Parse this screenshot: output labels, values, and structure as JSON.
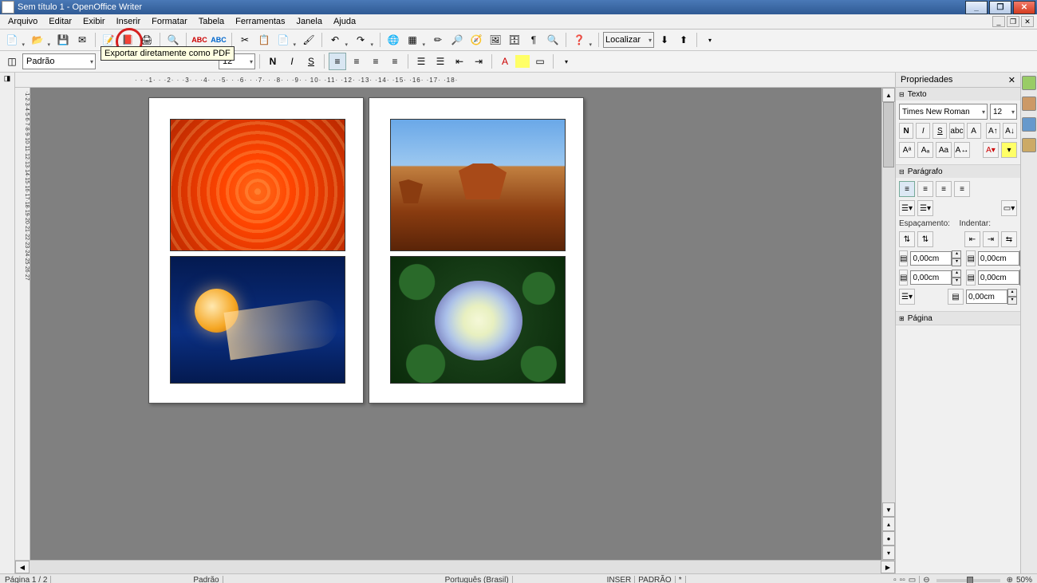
{
  "title": "Sem título 1 - OpenOffice Writer",
  "menu": [
    "Arquivo",
    "Editar",
    "Exibir",
    "Inserir",
    "Formatar",
    "Tabela",
    "Ferramentas",
    "Janela",
    "Ajuda"
  ],
  "tooltip": "Exportar diretamente como PDF",
  "find_placeholder": "Localizar",
  "style_combo": "Padrão",
  "font_combo": "Times New Roman",
  "size_combo": "12",
  "hruler": "· · ·1· · ·2· · ·3· · ·4· · ·5· · ·6· · ·7· · ·8· · ·9· · 10· ·11· ·12· ·13· ·14· ·15· ·16· ·17· ·18·",
  "vruler": "·1·2·3·4·5·6·7·8·9·10·11·12·13·14·15·16·17·18·19·20·21·22·23·24·25·26·27",
  "properties": {
    "title": "Propriedades",
    "sections": {
      "texto": "Texto",
      "paragrafo": "Parágrafo",
      "pagina": "Página"
    },
    "font": "Times New Roman",
    "size": "12",
    "spacing_label": "Espaçamento:",
    "indent_label": "Indentar:",
    "spin_zero": "0,00cm"
  },
  "status": {
    "page": "Página 1 / 2",
    "style": "Padrão",
    "lang": "Português (Brasil)",
    "insert": "INSER",
    "mode": "PADRÃO",
    "zoom": "50%"
  }
}
